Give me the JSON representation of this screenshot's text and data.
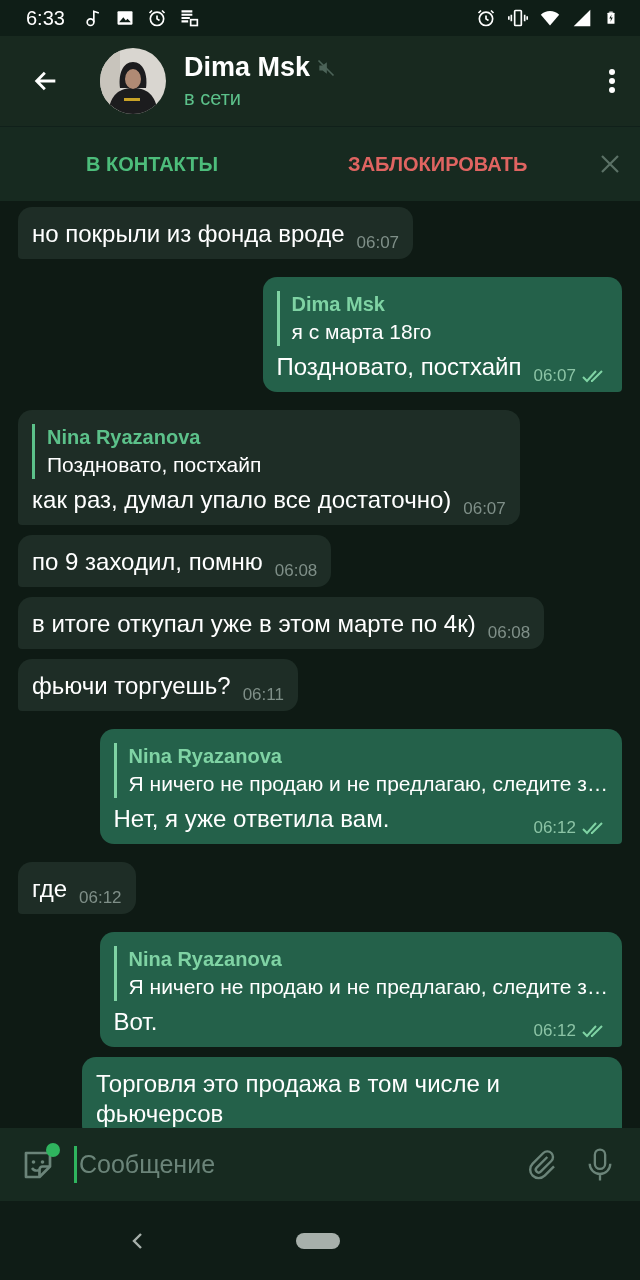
{
  "status_bar": {
    "time": "6:33"
  },
  "header": {
    "name": "Dima Msk",
    "status": "в сети",
    "muted": true
  },
  "action_bar": {
    "add_contact": "В КОНТАКТЫ",
    "block": "ЗАБЛОКИРОВАТЬ"
  },
  "messages": [
    {
      "kind": "in",
      "text": "но покрыли из фонда вроде",
      "time": "06:07"
    },
    {
      "kind": "out",
      "reply": {
        "name": "Dima Msk",
        "text": "я с марта 18го"
      },
      "text": "Поздновато, постхайп",
      "time": "06:07",
      "read": true
    },
    {
      "kind": "in",
      "reply": {
        "name": "Nina Ryazanova",
        "text": "Поздновато, постхайп"
      },
      "text": "как раз, думал упало все достаточно)",
      "time": "06:07"
    },
    {
      "kind": "in",
      "text": "по 9 заходил, помню",
      "time": "06:08"
    },
    {
      "kind": "in",
      "text": "в итоге откупал уже в этом марте по 4к)",
      "time": "06:08"
    },
    {
      "kind": "in",
      "text": "фьючи торгуешь?",
      "time": "06:11"
    },
    {
      "kind": "out",
      "reply": {
        "name": "Nina Ryazanova",
        "text": "Я ничего не продаю и не предлагаю, следите з…"
      },
      "text": "Нет, я уже ответила вам.",
      "time": "06:12",
      "read": true
    },
    {
      "kind": "in",
      "text": "где",
      "time": "06:12"
    },
    {
      "kind": "out",
      "reply": {
        "name": "Nina Ryazanova",
        "text": "Я ничего не продаю и не предлагаю, следите з…"
      },
      "text": "Вот.",
      "time": "06:12",
      "read": true
    },
    {
      "kind": "out",
      "text": "Торговля это продажа в том числе и фьючерсов"
    }
  ],
  "composer": {
    "placeholder": "Сообщение"
  }
}
